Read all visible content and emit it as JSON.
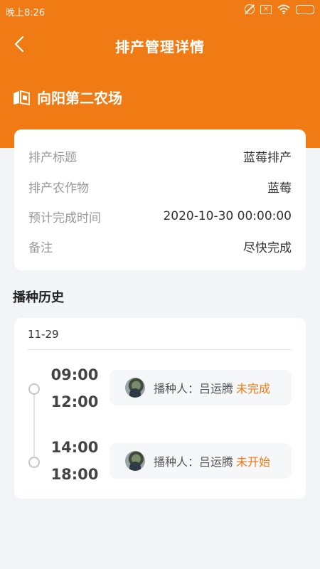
{
  "status_bar": {
    "time": "晚上8:26",
    "icons": [
      "alarm-off-icon",
      "notification-x-icon",
      "wifi-icon",
      "battery-icon"
    ]
  },
  "nav": {
    "back_icon": "chevron-left-icon",
    "title": "排产管理详情"
  },
  "farm": {
    "icon": "farm-map-icon",
    "name": "向阳第二农场"
  },
  "details": [
    {
      "label": "排产标题",
      "value": "蓝莓排产"
    },
    {
      "label": "排产农作物",
      "value": "蓝莓"
    },
    {
      "label": "预计完成时间",
      "value": "2020-10-30 00:00:00"
    },
    {
      "label": "备注",
      "value": "尽快完成"
    }
  ],
  "history": {
    "title": "播种历史",
    "date": "11-29",
    "records": [
      {
        "start": "09:00",
        "end": "12:00",
        "person_label": "播种人：吕运腾",
        "status": "未完成"
      },
      {
        "start": "14:00",
        "end": "18:00",
        "person_label": "播种人：吕运腾",
        "status": "未开始"
      }
    ]
  },
  "colors": {
    "brand": "#f07a14",
    "background": "#f2f4f7",
    "card": "#ffffff",
    "label": "#999999",
    "status": "#f07a14"
  }
}
